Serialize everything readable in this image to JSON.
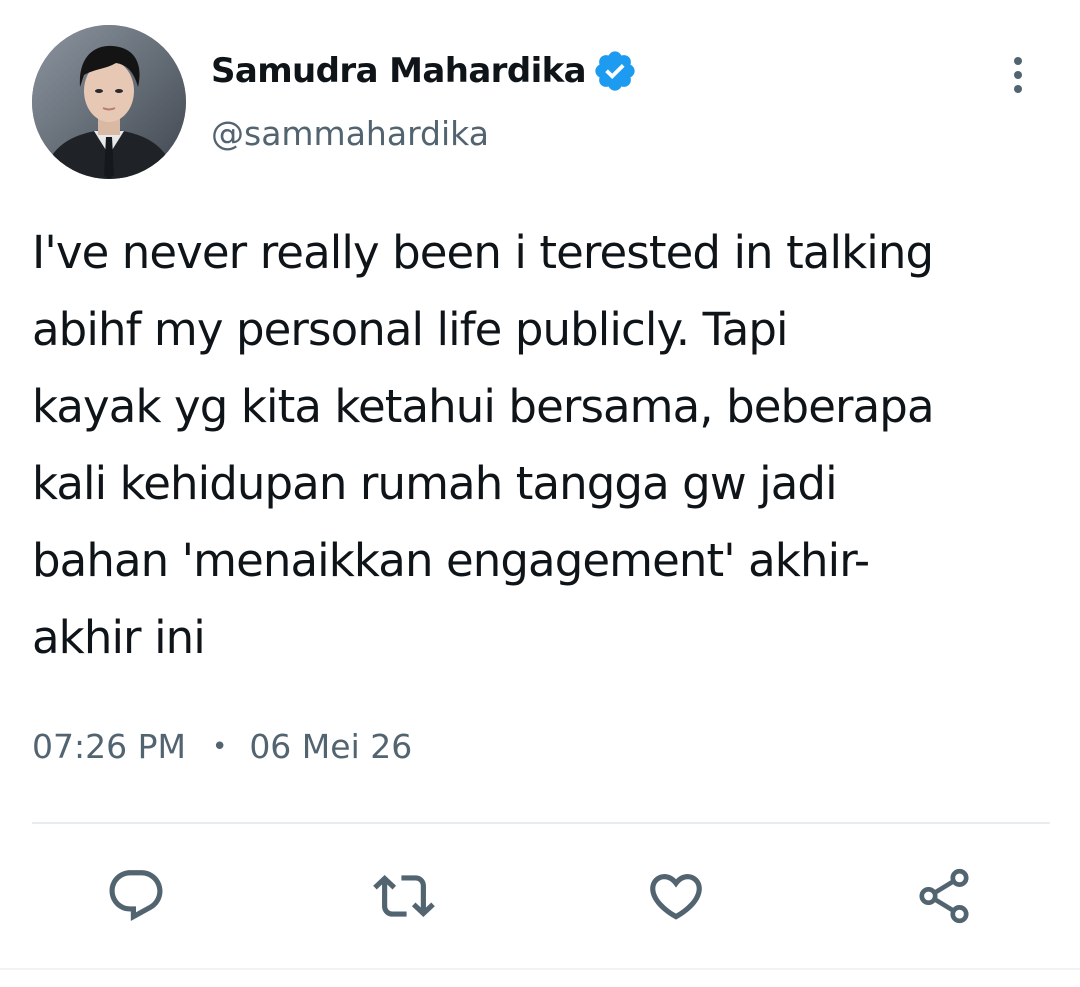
{
  "author": {
    "display_name": "Samudra Mahardika",
    "handle": "@sammahardika",
    "verified": true,
    "avatar": "profile-photo"
  },
  "tweet": {
    "text_lines": [
      "I've never really been i terested in talking",
      "abihf my personal life publicly. Tapi",
      "kayak yg kita ketahui bersama, beberapa",
      "kali kehidupan rumah tangga gw jadi",
      "bahan 'menaikkan engagement' akhir-",
      "akhir ini"
    ],
    "time": "07:26 PM",
    "separator": "•",
    "date": "06 Mei 26"
  },
  "actions": [
    {
      "icon": "reply-icon"
    },
    {
      "icon": "retweet-icon"
    },
    {
      "icon": "like-icon"
    },
    {
      "icon": "share-icon"
    }
  ],
  "colors": {
    "text": "#0f1419",
    "secondary": "#536471",
    "verified": "#1d9bf0",
    "divider": "#e6ecf0"
  }
}
